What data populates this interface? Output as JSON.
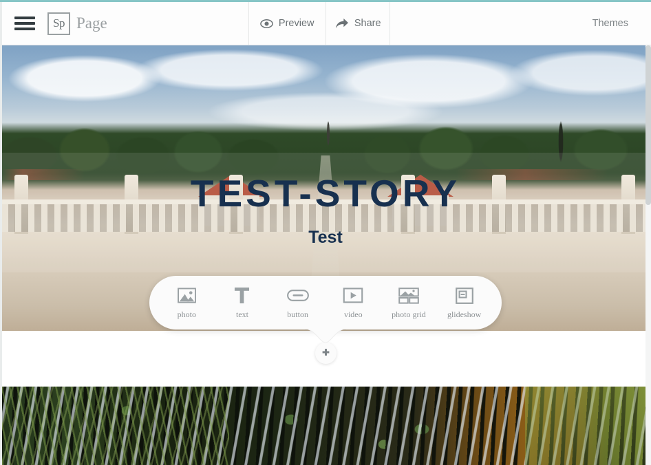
{
  "header": {
    "menu_icon": "hamburger-icon",
    "brand_mark": "Sp",
    "brand_title": "Page",
    "preview_label": "Preview",
    "preview_icon": "eye-icon",
    "share_label": "Share",
    "share_icon": "share-arrow-icon",
    "themes_label": "Themes"
  },
  "hero": {
    "title": "TEST-STORY",
    "subtitle": "Test",
    "title_color": "#17304f",
    "photo_alt": "palace-garden-panorama"
  },
  "insert_toolbar": {
    "items": [
      {
        "label": "photo",
        "icon": "photo-icon"
      },
      {
        "label": "text",
        "icon": "text-t-icon"
      },
      {
        "label": "button",
        "icon": "button-pill-icon"
      },
      {
        "label": "video",
        "icon": "video-play-icon"
      },
      {
        "label": "photo grid",
        "icon": "photo-grid-icon"
      },
      {
        "label": "glideshow",
        "icon": "glideshow-icon"
      }
    ],
    "add_button_icon": "plus-icon"
  },
  "second_section": {
    "photo_alt": "pond-reeds-reflection"
  },
  "colors": {
    "browser_accent": "#86c5c6",
    "header_bg": "#fdfdfd",
    "header_text": "#6b7275",
    "toolbar_bg": "#fbfbfb",
    "icon_gray": "#9aa1a4",
    "label_gray": "#8d9295"
  }
}
